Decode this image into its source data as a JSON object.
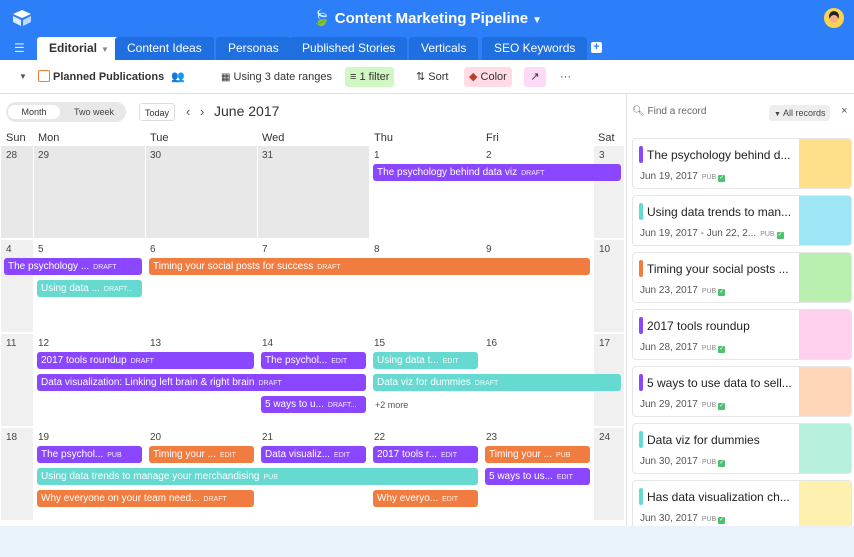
{
  "app": {
    "title": "Content Marketing Pipeline"
  },
  "tabs": [
    {
      "label": "Editorial",
      "active": true
    },
    {
      "label": "Content Ideas"
    },
    {
      "label": "Personas"
    },
    {
      "label": "Published Stories"
    },
    {
      "label": "Verticals"
    },
    {
      "label": "SEO Keywords"
    }
  ],
  "toolbar": {
    "view_name": "Planned Publications",
    "date_ranges": "Using 3 date ranges",
    "filter": "1 filter",
    "sort": "Sort",
    "color": "Color",
    "more": "···"
  },
  "calendar": {
    "view_modes": [
      "Month",
      "Two week"
    ],
    "today": "Today",
    "month_title": "June 2017",
    "weekdays": [
      "Sun",
      "Mon",
      "Tue",
      "Wed",
      "Thu",
      "Fri",
      "Sat"
    ],
    "weeks": [
      [
        "28",
        "29",
        "30",
        "31",
        "1",
        "2",
        "3"
      ],
      [
        "4",
        "5",
        "6",
        "7",
        "8",
        "9",
        "10"
      ],
      [
        "11",
        "12",
        "13",
        "14",
        "15",
        "16",
        "17"
      ],
      [
        "18",
        "19",
        "20",
        "21",
        "22",
        "23",
        "24"
      ]
    ],
    "more_label": "+2 more",
    "events": [
      {
        "week": 0,
        "row": 0,
        "start": 4,
        "end": 6,
        "color": "purple",
        "title": "The psychology behind data viz",
        "status": "DRAFT"
      },
      {
        "week": 1,
        "row": 0,
        "start": 0,
        "end": 1,
        "color": "purple",
        "title": "The psychology ...",
        "status": "DRAFT"
      },
      {
        "week": 1,
        "row": 0,
        "start": 2,
        "end": 5,
        "color": "orange",
        "title": "Timing your social posts for success",
        "status": "DRAFT"
      },
      {
        "week": 1,
        "row": 1,
        "start": 1,
        "end": 1,
        "color": "teal",
        "title": "Using data ...",
        "status": "DRAFT..."
      },
      {
        "week": 2,
        "row": 0,
        "start": 1,
        "end": 2,
        "color": "purple",
        "title": "2017 tools roundup",
        "status": "DRAFT"
      },
      {
        "week": 2,
        "row": 0,
        "start": 3,
        "end": 3,
        "color": "purple",
        "title": "The psychol...",
        "status": "EDIT"
      },
      {
        "week": 2,
        "row": 0,
        "start": 4,
        "end": 4,
        "color": "teal",
        "title": "Using data t...",
        "status": "EDIT"
      },
      {
        "week": 2,
        "row": 1,
        "start": 1,
        "end": 3,
        "color": "purple",
        "title": "Data visualization: Linking left brain & right brain",
        "status": "DRAFT"
      },
      {
        "week": 2,
        "row": 1,
        "start": 4,
        "end": 6,
        "color": "teal",
        "title": "Data viz for dummies",
        "status": "DRAFT"
      },
      {
        "week": 2,
        "row": 2,
        "start": 3,
        "end": 3,
        "color": "purple",
        "title": "5 ways to u...",
        "status": "DRAFT..."
      },
      {
        "week": 3,
        "row": 0,
        "start": 1,
        "end": 1,
        "color": "purple",
        "title": "The psychol...",
        "status": "PUB"
      },
      {
        "week": 3,
        "row": 0,
        "start": 2,
        "end": 2,
        "color": "orange",
        "title": "Timing your ...",
        "status": "EDIT"
      },
      {
        "week": 3,
        "row": 0,
        "start": 3,
        "end": 3,
        "color": "purple",
        "title": "Data visualiz...",
        "status": "EDIT"
      },
      {
        "week": 3,
        "row": 0,
        "start": 4,
        "end": 4,
        "color": "purple",
        "title": "2017 tools r...",
        "status": "EDIT"
      },
      {
        "week": 3,
        "row": 0,
        "start": 5,
        "end": 5,
        "color": "orange",
        "title": "Timing your ...",
        "status": "PUB"
      },
      {
        "week": 3,
        "row": 1,
        "start": 1,
        "end": 4,
        "color": "teal",
        "title": "Using data trends to manage your merchandising",
        "status": "PUB"
      },
      {
        "week": 3,
        "row": 1,
        "start": 5,
        "end": 5,
        "color": "purple",
        "title": "5 ways to us...",
        "status": "EDIT"
      },
      {
        "week": 3,
        "row": 2,
        "start": 1,
        "end": 2,
        "color": "orange",
        "title": "Why everyone on your team need...",
        "status": "DRAFT"
      },
      {
        "week": 3,
        "row": 2,
        "start": 4,
        "end": 4,
        "color": "orange",
        "title": "Why everyo...",
        "status": "EDIT"
      }
    ]
  },
  "sidebar": {
    "search_placeholder": "Find a record",
    "filter_label": "All records",
    "close": "×",
    "cards": [
      {
        "title": "The psychology behind d...",
        "date": "Jun 19, 2017",
        "status": "PUB",
        "color": "#8b46ff",
        "thumb": "#ffe08a"
      },
      {
        "title": "Using data trends to man...",
        "date": "Jun 19, 2017 - Jun 22, 2...",
        "status": "PUB",
        "color": "#66d9d1",
        "thumb": "#9ee6f5"
      },
      {
        "title": "Timing your social posts ...",
        "date": "Jun 23, 2017",
        "status": "PUB",
        "color": "#f07c3f",
        "thumb": "#b9f0b0"
      },
      {
        "title": "2017 tools roundup",
        "date": "Jun 28, 2017",
        "status": "PUB",
        "color": "#8b46ff",
        "thumb": "#ffd0ee"
      },
      {
        "title": "5 ways to use data to sell...",
        "date": "Jun 29, 2017",
        "status": "PUB",
        "color": "#8b46ff",
        "thumb": "#ffd7b8"
      },
      {
        "title": "Data viz for dummies",
        "date": "Jun 30, 2017",
        "status": "PUB",
        "color": "#66d9d1",
        "thumb": "#b6f0dd"
      },
      {
        "title": "Has data visualization ch...",
        "date": "Jun 30, 2017",
        "status": "PUB",
        "color": "#66d9d1",
        "thumb": "#fff0b0"
      }
    ]
  },
  "colors": {
    "brand": "#2d7ff9",
    "purple": "#8b46ff",
    "teal": "#66d9d1",
    "orange": "#f07c3f"
  }
}
